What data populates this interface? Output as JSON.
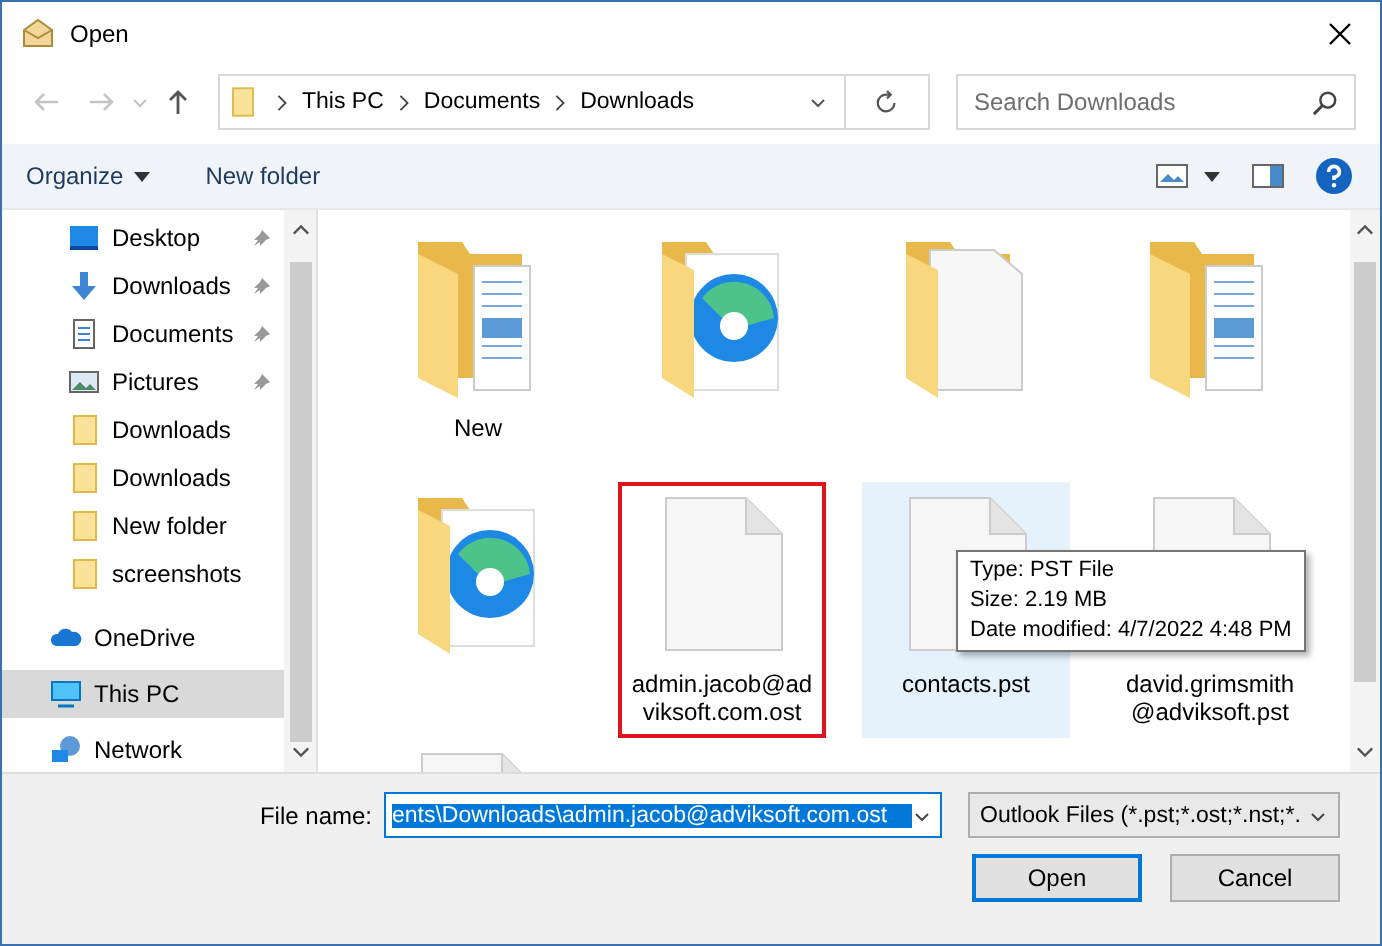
{
  "window": {
    "title": "Open"
  },
  "address": {
    "path": [
      "This PC",
      "Documents",
      "Downloads"
    ]
  },
  "search": {
    "placeholder": "Search Downloads"
  },
  "toolbar": {
    "buttons": [
      "Organize",
      "New folder"
    ]
  },
  "sidebar": {
    "quick_access": [
      {
        "label": "Desktop",
        "kind": "desktop",
        "pinned": true,
        "selected": false
      },
      {
        "label": "Downloads",
        "kind": "download",
        "pinned": true,
        "selected": false
      },
      {
        "label": "Documents",
        "kind": "documents",
        "pinned": true,
        "selected": false
      },
      {
        "label": "Pictures",
        "kind": "pictures",
        "pinned": true,
        "selected": false
      },
      {
        "label": "Downloads",
        "kind": "folder",
        "pinned": false,
        "selected": false
      },
      {
        "label": "Downloads",
        "kind": "folder",
        "pinned": false,
        "selected": false
      },
      {
        "label": "New folder",
        "kind": "folder",
        "pinned": false,
        "selected": false
      },
      {
        "label": "screenshots",
        "kind": "folder",
        "pinned": false,
        "selected": false
      }
    ],
    "locations": [
      {
        "label": "OneDrive",
        "kind": "cloud",
        "selected": false
      },
      {
        "label": "This PC",
        "kind": "pc",
        "selected": true
      },
      {
        "label": "Network",
        "kind": "network",
        "selected": false
      }
    ]
  },
  "files": [
    {
      "kind": "folder-docs",
      "label": "New",
      "hovered": false,
      "annotated": false
    },
    {
      "kind": "folder-edge",
      "hovered": false,
      "annotated": false
    },
    {
      "kind": "folder-file",
      "hovered": false,
      "annotated": false
    },
    {
      "kind": "folder-docs",
      "hovered": false,
      "annotated": false
    },
    {
      "kind": "folder-edge",
      "hovered": false,
      "annotated": false
    },
    {
      "kind": "file",
      "label": "admin.jacob@adviksoft.com.ost",
      "hovered": false,
      "annotated": true
    },
    {
      "kind": "file",
      "label": "contacts.pst",
      "hovered": true,
      "annotated": false
    },
    {
      "kind": "file",
      "label": "david.grimsmith@adviksoft.pst",
      "hovered": false,
      "annotated": false
    },
    {
      "kind": "file",
      "hovered": false,
      "annotated": false
    }
  ],
  "tooltip": {
    "lines": [
      "Type: PST File",
      "Size: 2.19 MB",
      "Date modified: 4/7/2022 4:48 PM"
    ]
  },
  "file_name": {
    "label": "File name:",
    "value": "ents\\Downloads\\admin.jacob@adviksoft.com.ost"
  },
  "file_type": {
    "value": "Outlook Files (*.pst;*.ost;*.nst;*."
  },
  "buttons": [
    {
      "label": "Open",
      "default": true
    },
    {
      "label": "Cancel",
      "default": false
    }
  ]
}
